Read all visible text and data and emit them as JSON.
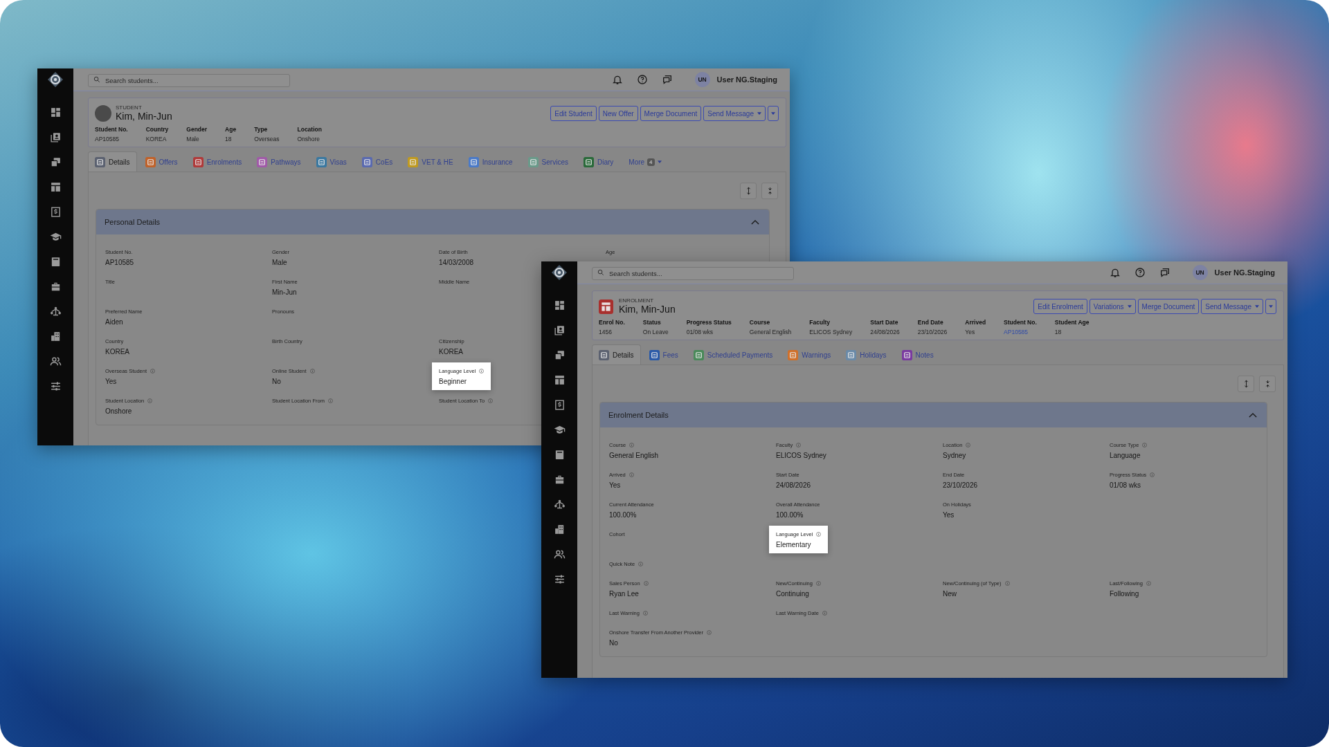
{
  "windows": [
    {
      "search": {
        "placeholder": "Search students..."
      },
      "user": {
        "initials": "UN",
        "name": "User NG.Staging"
      },
      "record": {
        "kind": "student",
        "type_label": "STUDENT",
        "name": "Kim, Min-Jun"
      },
      "actions": [
        {
          "kind": "text",
          "label": "Edit Student",
          "dropdown": false
        },
        {
          "kind": "text",
          "label": "New Offer",
          "dropdown": false
        },
        {
          "kind": "text",
          "label": "Merge Document",
          "dropdown": false
        },
        {
          "kind": "text",
          "label": "Send Message",
          "dropdown": true
        },
        {
          "kind": "caret"
        }
      ],
      "summary": [
        {
          "label": "Student No.",
          "value": "AP10585"
        },
        {
          "label": "Country",
          "value": "KOREA"
        },
        {
          "label": "Gender",
          "value": "Male"
        },
        {
          "label": "Age",
          "value": "18"
        },
        {
          "label": "Type",
          "value": "Overseas"
        },
        {
          "label": "Location",
          "value": "Onshore"
        }
      ],
      "tabs": [
        {
          "label": "Details",
          "selected": true,
          "color": "#5b6170"
        },
        {
          "label": "Offers",
          "selected": false,
          "color": "#c0622a"
        },
        {
          "label": "Enrolments",
          "selected": false,
          "color": "#b03a3a"
        },
        {
          "label": "Pathways",
          "selected": false,
          "color": "#a05aa8"
        },
        {
          "label": "Visas",
          "selected": false,
          "color": "#3a78a0"
        },
        {
          "label": "CoEs",
          "selected": false,
          "color": "#5a6ab0"
        },
        {
          "label": "VET & HE",
          "selected": false,
          "color": "#c09a20"
        },
        {
          "label": "Insurance",
          "selected": false,
          "color": "#4a7ac8"
        },
        {
          "label": "Services",
          "selected": false,
          "color": "#6a9a8a"
        },
        {
          "label": "Diary",
          "selected": false,
          "color": "#2a6a3a"
        }
      ],
      "more": {
        "label": "More",
        "count": "4"
      },
      "panel": {
        "title": "Personal Details",
        "expanded": true,
        "rows": [
          [
            {
              "label": "Student No.",
              "value": "AP10585",
              "info": false
            },
            {
              "label": "Gender",
              "value": "Male",
              "info": false
            },
            {
              "label": "Date of Birth",
              "value": "14/03/2008",
              "info": false
            },
            {
              "label": "Age",
              "info": false
            }
          ],
          [
            {
              "label": "Title",
              "info": false
            },
            {
              "label": "First Name",
              "value": "Min-Jun",
              "info": false
            },
            {
              "label": "Middle Name",
              "info": false
            }
          ],
          [
            {
              "label": "Preferred Name",
              "value": "Aiden",
              "info": false
            },
            {
              "label": "Pronouns",
              "info": false
            }
          ],
          [
            {
              "label": "Country",
              "value": "KOREA",
              "info": false
            },
            {
              "label": "Birth Country",
              "info": false
            },
            {
              "label": "Citizenship",
              "value": "KOREA",
              "info": false
            }
          ],
          [
            {
              "label": "Overseas Student",
              "value": "Yes",
              "info": true
            },
            {
              "label": "Online Student",
              "value": "No",
              "info": true
            },
            {
              "label": "Language Level",
              "value": "Beginner",
              "info": true,
              "highlighted": true
            }
          ],
          [
            {
              "label": "Student Location",
              "value": "Onshore",
              "info": true
            },
            {
              "label": "Student Location From",
              "info": true
            },
            {
              "label": "Student Location To",
              "info": true
            }
          ]
        ]
      }
    },
    {
      "search": {
        "placeholder": "Search students..."
      },
      "user": {
        "initials": "UN",
        "name": "User NG.Staging"
      },
      "record": {
        "kind": "enrolment",
        "type_label": "ENROLMENT",
        "name": "Kim, Min-Jun"
      },
      "actions": [
        {
          "kind": "text",
          "label": "Edit Enrolment",
          "dropdown": false
        },
        {
          "kind": "text",
          "label": "Variations",
          "dropdown": true
        },
        {
          "kind": "text",
          "label": "Merge Document",
          "dropdown": false
        },
        {
          "kind": "text",
          "label": "Send Message",
          "dropdown": true
        },
        {
          "kind": "caret"
        }
      ],
      "summary": [
        {
          "label": "Enrol No.",
          "value": "1456"
        },
        {
          "label": "Status",
          "value": "On Leave"
        },
        {
          "label": "Progress Status",
          "value": "01/08 wks"
        },
        {
          "label": "Course",
          "value": "General English"
        },
        {
          "label": "Faculty",
          "value": "ELICOS Sydney"
        },
        {
          "label": "Start Date",
          "value": "24/08/2026"
        },
        {
          "label": "End Date",
          "value": "23/10/2026"
        },
        {
          "label": "Arrived",
          "value": "Yes"
        },
        {
          "label": "Student No.",
          "value": "AP10585",
          "link": true
        },
        {
          "label": "Student Age",
          "value": "18"
        }
      ],
      "tabs": [
        {
          "label": "Details",
          "selected": true,
          "color": "#5b6170"
        },
        {
          "label": "Fees",
          "selected": false,
          "color": "#2a5aa8"
        },
        {
          "label": "Scheduled Payments",
          "selected": false,
          "color": "#4a8a5a"
        },
        {
          "label": "Warnings",
          "selected": false,
          "color": "#d0702a"
        },
        {
          "label": "Holidays",
          "selected": false,
          "color": "#6a8aa8"
        },
        {
          "label": "Notes",
          "selected": false,
          "color": "#7a3aa0"
        }
      ],
      "panel": {
        "title": "Enrolment Details",
        "expanded": true,
        "rows": [
          [
            {
              "label": "Course",
              "value": "General English",
              "info": true
            },
            {
              "label": "Faculty",
              "value": "ELICOS Sydney",
              "info": true
            },
            {
              "label": "Location",
              "value": "Sydney",
              "info": true
            },
            {
              "label": "Course Type",
              "value": "Language",
              "info": true
            }
          ],
          [
            {
              "label": "Arrived",
              "value": "Yes",
              "info": true
            },
            {
              "label": "Start Date",
              "value": "24/08/2026",
              "info": false
            },
            {
              "label": "End Date",
              "value": "23/10/2026",
              "info": false
            },
            {
              "label": "Progress Status",
              "value": "01/08 wks",
              "info": true
            }
          ],
          [
            {
              "label": "Current Attendance",
              "value": "100.00%",
              "info": false
            },
            {
              "label": "Overall Attendance",
              "value": "100.00%",
              "info": false
            },
            {
              "label": "On Holidays",
              "value": "Yes",
              "info": false
            }
          ],
          [
            {
              "label": "Cohort",
              "info": false
            },
            {
              "label": "Language Level",
              "value": "Elementary",
              "info": true,
              "highlighted": true
            }
          ],
          [
            {
              "label": "Quick Note",
              "info": true
            }
          ],
          [
            {
              "label": "Sales Person",
              "value": "Ryan Lee",
              "info": true
            },
            {
              "label": "New/Continuing",
              "value": "Continuing",
              "info": true
            },
            {
              "label": "New/Continuing (of Type)",
              "value": "New",
              "info": true
            },
            {
              "label": "Last/Following",
              "value": "Following",
              "info": true
            }
          ],
          [
            {
              "label": "Last Warning",
              "info": true
            },
            {
              "label": "Last Warning Date",
              "info": true
            }
          ],
          [
            {
              "label": "Onshore Transfer From Another Provider",
              "value": "No",
              "info": true
            }
          ]
        ]
      }
    }
  ]
}
